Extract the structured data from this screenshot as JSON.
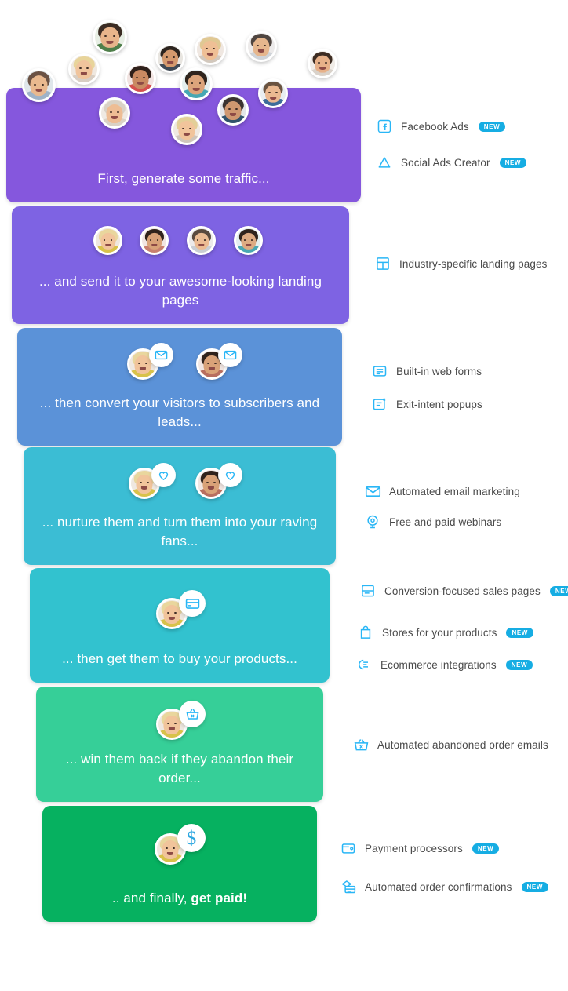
{
  "funnel": {
    "steps": [
      {
        "id": "traffic",
        "caption": "First, generate some traffic...",
        "color": "#8557dd",
        "badge_icon": "none"
      },
      {
        "id": "landing-pages",
        "caption": "... and send it to your awesome-looking landing pages",
        "color": "#7e63e3",
        "badge_icon": "none"
      },
      {
        "id": "subscribers",
        "caption": "... then convert your visitors to subscribers and leads...",
        "color": "#5b92d8",
        "badge_icon": "envelope-icon"
      },
      {
        "id": "nurture",
        "caption": "... nurture them  and turn them into your raving fans...",
        "color": "#3bbdd4",
        "badge_icon": "heart-icon"
      },
      {
        "id": "buy",
        "caption": "... then get them to buy your products...",
        "color": "#32c2cf",
        "badge_icon": "credit-card-icon"
      },
      {
        "id": "abandon",
        "caption": "... win them back if they abandon their order...",
        "color": "#36cf98",
        "badge_icon": "basket-x-icon"
      },
      {
        "id": "get-paid",
        "caption": ".. and finally, ",
        "caption_bold": "get paid!",
        "color": "#06b160",
        "badge_icon": "dollar-icon"
      }
    ]
  },
  "features": [
    {
      "id": "facebook-ads",
      "label": "Facebook Ads",
      "icon": "facebook-icon",
      "badge": "NEW"
    },
    {
      "id": "social-ads-creator",
      "label": "Social Ads Creator",
      "icon": "triangle-icon",
      "badge": "NEW"
    },
    {
      "id": "landing-pages",
      "label": "Industry-specific landing pages",
      "icon": "layout-icon",
      "badge": ""
    },
    {
      "id": "web-forms",
      "label": "Built-in web forms",
      "icon": "form-icon",
      "badge": ""
    },
    {
      "id": "exit-popups",
      "label": "Exit-intent popups",
      "icon": "popup-icon",
      "badge": ""
    },
    {
      "id": "email-marketing",
      "label": "Automated email marketing",
      "icon": "envelope-icon",
      "badge": ""
    },
    {
      "id": "webinars",
      "label": "Free and paid webinars",
      "icon": "webinar-icon",
      "badge": ""
    },
    {
      "id": "sales-pages",
      "label": "Conversion-focused sales pages",
      "icon": "sales-page-icon",
      "badge": "NEW"
    },
    {
      "id": "stores",
      "label": "Stores for your products",
      "icon": "shopping-bag-icon",
      "badge": "NEW"
    },
    {
      "id": "ecommerce",
      "label": "Ecommerce integrations",
      "icon": "plug-icon",
      "badge": "NEW"
    },
    {
      "id": "abandoned-orders",
      "label": "Automated abandoned order emails",
      "icon": "basket-x-icon",
      "badge": ""
    },
    {
      "id": "payment-processors",
      "label": "Payment processors",
      "icon": "wallet-icon",
      "badge": "NEW"
    },
    {
      "id": "order-confirmations",
      "label": "Automated order confirmations",
      "icon": "mail-card-icon",
      "badge": "NEW"
    }
  ],
  "colors": {
    "accent": "#29b6f6",
    "badge": "#16ade3",
    "text": "#4a4a4a"
  }
}
